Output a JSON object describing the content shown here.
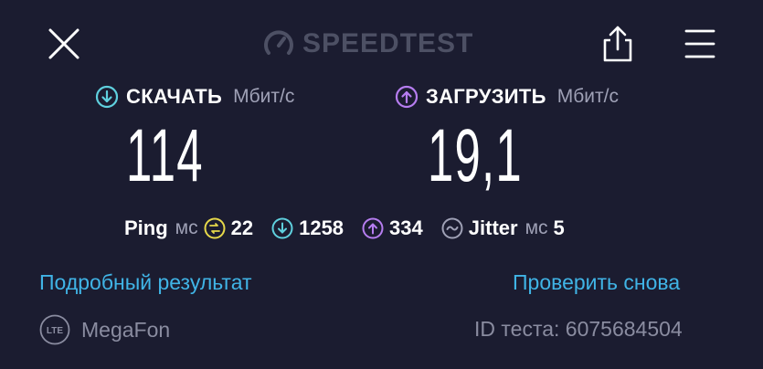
{
  "header": {
    "logo_text": "SPEEDTEST",
    "icons": [
      "close-icon",
      "speedometer-icon",
      "share-icon",
      "menu-icon"
    ]
  },
  "download": {
    "title": "СКАЧАТЬ",
    "unit": "Мбит/с",
    "value": "114",
    "color": "#5fd0de"
  },
  "upload": {
    "title": "ЗАГРУЗИТЬ",
    "unit": "Мбит/с",
    "value": "19,1",
    "color": "#b67df0"
  },
  "stats": {
    "ping_label": "Ping",
    "ping_unit": "мс",
    "ping_value": "22",
    "ping_color": "#e6d84a",
    "download_latency": "1258",
    "upload_latency": "334",
    "jitter_label": "Jitter",
    "jitter_unit": "мс",
    "jitter_value": "5"
  },
  "links": {
    "details": "Подробный результат",
    "retest": "Проверить снова"
  },
  "footer": {
    "network_badge": "LTE",
    "provider": "MegaFon",
    "test_id": "ID теста: 6075684504"
  },
  "colors": {
    "background": "#1b1c30",
    "link": "#40b4e6",
    "muted": "#8a8ca0"
  }
}
